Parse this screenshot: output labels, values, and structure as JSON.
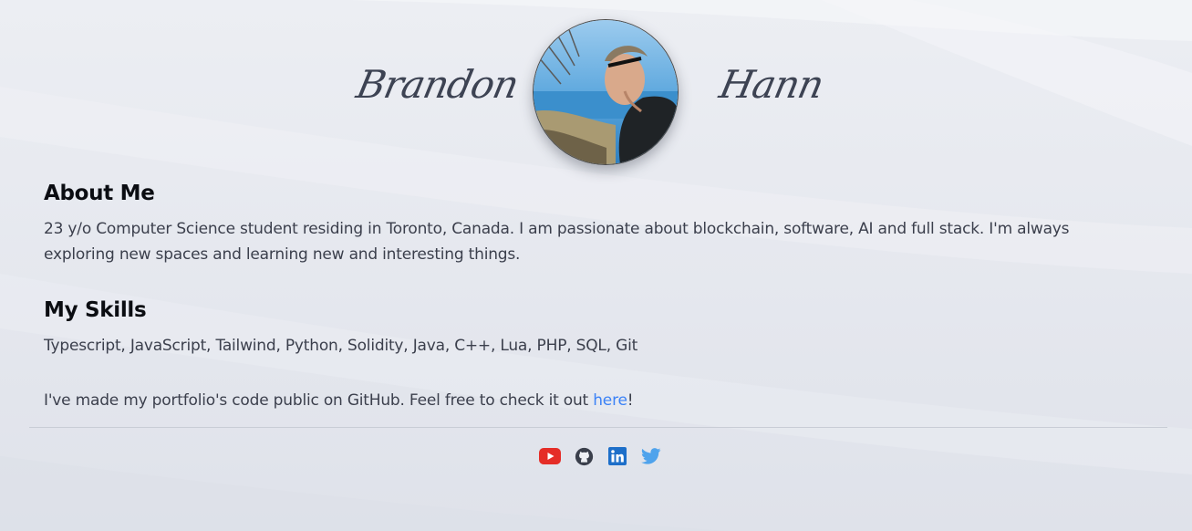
{
  "header": {
    "first_name": "Brandon",
    "last_name": "Hann",
    "avatar_alt": "profile-photo"
  },
  "about": {
    "title": "About Me",
    "text": "23 y/o Computer Science student residing in Toronto, Canada. I am passionate about blockchain, software, AI and full stack. I'm always exploring new spaces and learning new and interesting things."
  },
  "skills": {
    "title": "My Skills",
    "text": "Typescript, JavaScript, Tailwind, Python, Solidity, Java, C++, Lua, PHP, SQL, Git"
  },
  "github_note": {
    "before": "I've made my portfolio's code public on GitHub. Feel free to check it out ",
    "link_text": "here",
    "after": "!"
  },
  "socials": [
    {
      "icon": "youtube-icon",
      "color": "#e52d27"
    },
    {
      "icon": "github-icon",
      "color": "#3a3f4b"
    },
    {
      "icon": "linkedin-icon",
      "color": "#1d6fc9"
    },
    {
      "icon": "twitter-icon",
      "color": "#4fa3ec"
    }
  ],
  "colors": {
    "link": "#3b82f6",
    "heading": "#0b0d12",
    "body_text": "#3b3f4c",
    "background": "#e3e6ee"
  }
}
